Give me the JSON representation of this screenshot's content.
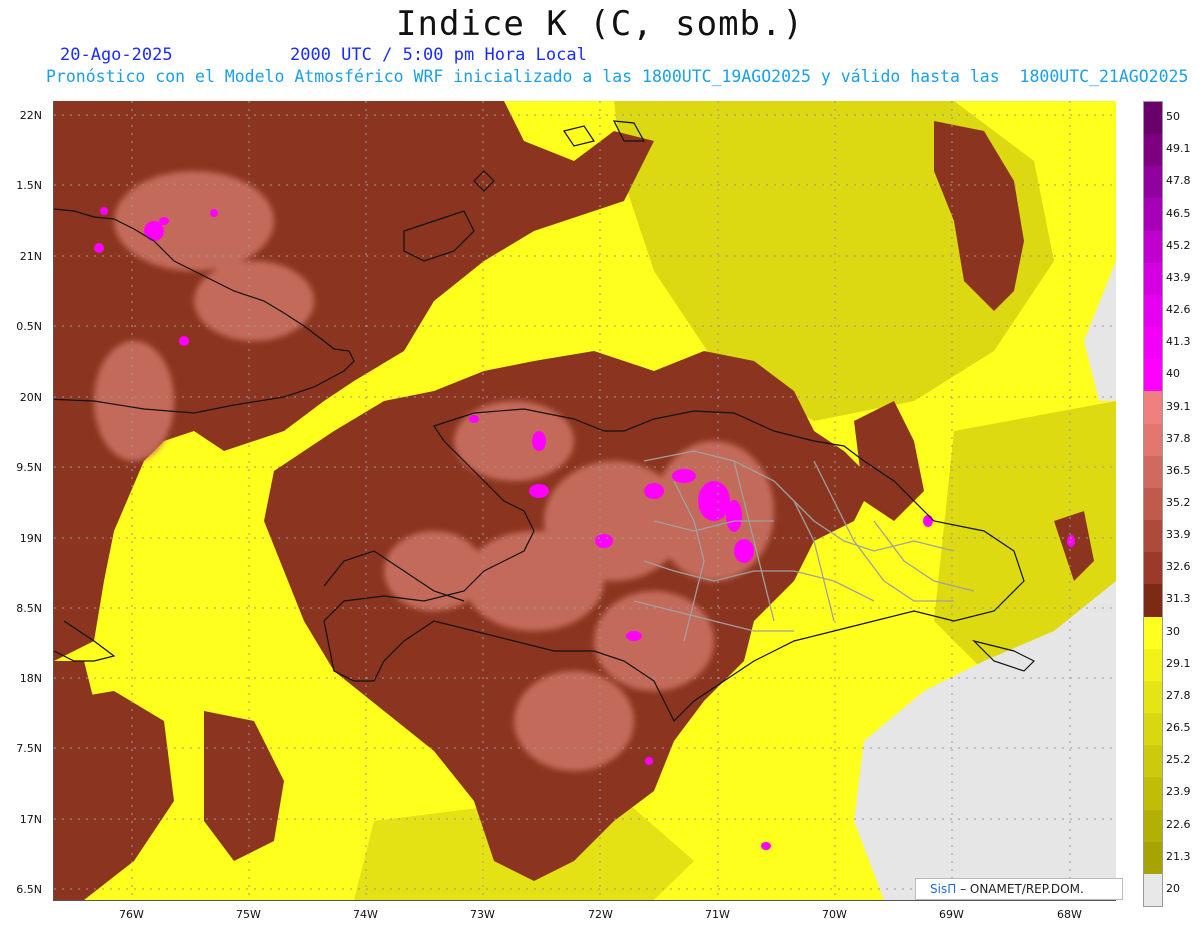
{
  "title": "Indice K (C, somb.)",
  "date": "20-Ago-2025",
  "valid_time": "2000 UTC / 5:00 pm Hora Local",
  "model_line": "Pronóstico con el Modelo Atmosférico WRF inicializado a las 1800UTC_19AGO2025 y válido hasta las  1800UTC_21AGO2025",
  "credit": {
    "brand": "SisΠ",
    "text": "– ONAMET/REP.DOM."
  },
  "y_axis_labels": [
    "22N",
    "1.5N",
    "21N",
    "0.5N",
    "20N",
    "9.5N",
    "19N",
    "8.5N",
    "18N",
    "7.5N",
    "17N",
    "6.5N"
  ],
  "x_axis_labels": [
    "76W",
    "75W",
    "74W",
    "73W",
    "72W",
    "71W",
    "70W",
    "69W",
    "68W"
  ],
  "legend": {
    "values": [
      "50",
      "49.1",
      "47.8",
      "46.5",
      "45.2",
      "43.9",
      "42.6",
      "41.3",
      "40",
      "39.1",
      "37.8",
      "36.5",
      "35.2",
      "33.9",
      "32.6",
      "31.3",
      "30",
      "29.1",
      "27.8",
      "26.5",
      "25.2",
      "23.9",
      "22.6",
      "21.3",
      "20"
    ],
    "colors": [
      "#6a006a",
      "#7e0080",
      "#9200a0",
      "#a800b8",
      "#bf00cf",
      "#d400e2",
      "#e600f0",
      "#f300f8",
      "#ff00ff",
      "#f08080",
      "#e37770",
      "#d06a5e",
      "#c05a4c",
      "#ad4a3a",
      "#9b3a2a",
      "#7d2a15",
      "#ffff20",
      "#f2f218",
      "#e5e414",
      "#d9d710",
      "#ccca0c",
      "#bfbd08",
      "#b2b005",
      "#a6a302",
      "#e8e8e8"
    ]
  },
  "colors": {
    "moderate": "#8b3520",
    "high": "#c46a5a",
    "very_high": "#ff00ff",
    "low": "#ffff1e",
    "lower": "#d8d410",
    "none": "#e6e6e6"
  }
}
